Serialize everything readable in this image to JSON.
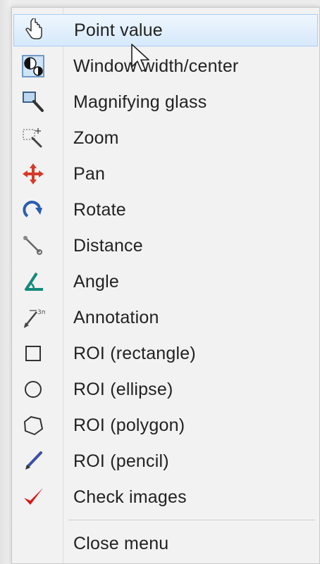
{
  "menu": {
    "items": [
      {
        "label": "Point value",
        "icon": "hand-pointer-icon"
      },
      {
        "label": "Window width/center",
        "icon": "contrast-icon"
      },
      {
        "label": "Magnifying glass",
        "icon": "magnifier-icon"
      },
      {
        "label": "Zoom",
        "icon": "zoom-icon"
      },
      {
        "label": "Pan",
        "icon": "pan-arrows-icon"
      },
      {
        "label": "Rotate",
        "icon": "rotate-icon"
      },
      {
        "label": "Distance",
        "icon": "ruler-line-icon"
      },
      {
        "label": "Angle",
        "icon": "angle-icon"
      },
      {
        "label": "Annotation",
        "icon": "annotation-arrow-icon"
      },
      {
        "label": "ROI (rectangle)",
        "icon": "rectangle-icon"
      },
      {
        "label": "ROI (ellipse)",
        "icon": "ellipse-icon"
      },
      {
        "label": "ROI (polygon)",
        "icon": "polygon-icon"
      },
      {
        "label": "ROI (pencil)",
        "icon": "pencil-icon"
      },
      {
        "label": "Check images",
        "icon": "checkmark-icon"
      }
    ],
    "close_label": "Close menu",
    "hovered_item": "Point value"
  },
  "colors": {
    "hover_bg": "#d6e9fb",
    "hover_border": "#a9cdf1",
    "check_red": "#d81818",
    "pan_red": "#d63a2a",
    "rotate_blue": "#2a5db0",
    "angle_teal": "#128a7a"
  }
}
